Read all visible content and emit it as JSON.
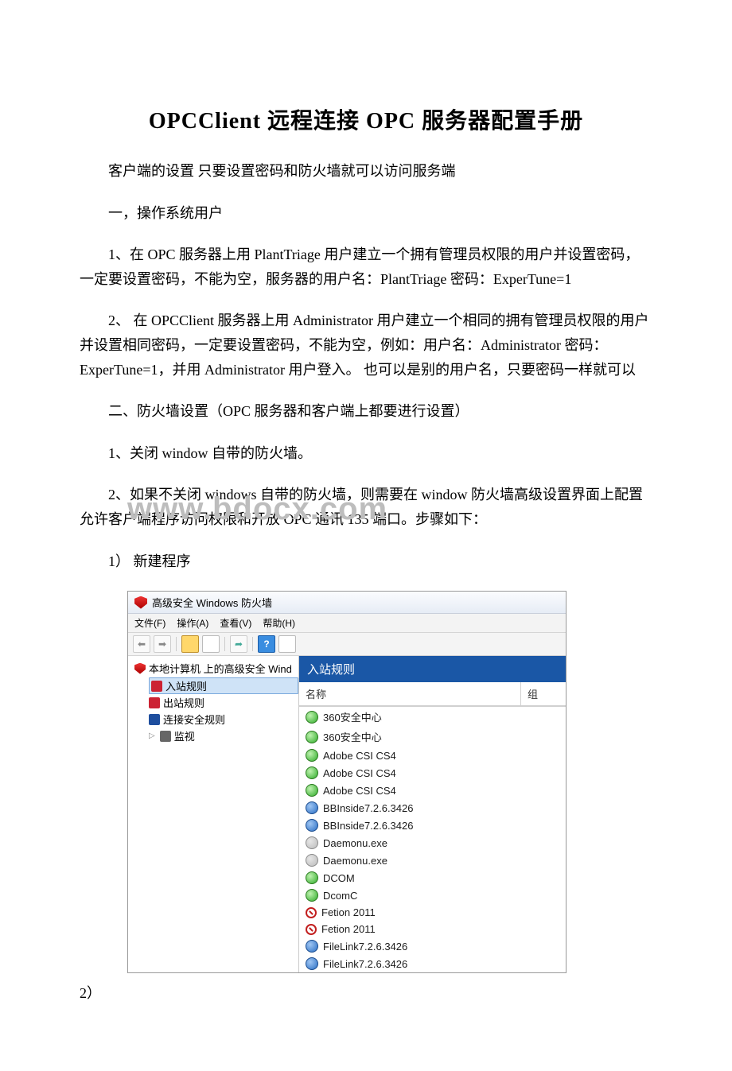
{
  "doc": {
    "title": "OPCClient 远程连接 OPC 服务器配置手册",
    "intro": "客户端的设置 只要设置密码和防火墙就可以访问服务端",
    "section1_heading": "一，操作系统用户",
    "section1_item1": "1、在 OPC 服务器上用 PlantTriage 用户建立一个拥有管理员权限的用户并设置密码，一定要设置密码，不能为空，服务器的用户名：PlantTriage 密码：ExperTune=1",
    "section1_item2": "2、 在 OPCClient 服务器上用 Administrator 用户建立一个相同的拥有管理员权限的用户并设置相同密码，一定要设置密码，不能为空，例如：用户名：Administrator 密码：ExperTune=1，并用 Administrator 用户登入。 也可以是别的用户名，只要密码一样就可以",
    "section2_heading": "二、防火墙设置（OPC 服务器和客户端上都要进行设置）",
    "section2_item1": "1、关闭 window 自带的防火墙。",
    "section2_item2": "2、如果不关闭 windows 自带的防火墙，则需要在 window 防火墙高级设置界面上配置允许客户端程序访问权限和开放 OPC 通讯 135 端口。步骤如下：",
    "step1": "1） 新建程序",
    "step2": "2）",
    "watermark": "www.bdocx.com"
  },
  "window": {
    "title": "高级安全 Windows 防火墙",
    "menu": {
      "file": "文件(F)",
      "action": "操作(A)",
      "view": "查看(V)",
      "help": "帮助(H)"
    },
    "tree": {
      "root": "本地计算机 上的高级安全 Wind",
      "inbound": "入站规则",
      "outbound": "出站规则",
      "conn": "连接安全规则",
      "monitor": "监视"
    },
    "content": {
      "header": "入站规则",
      "col_name": "名称",
      "col_group": "组",
      "rules": [
        {
          "status": "allow-green",
          "name": "360安全中心"
        },
        {
          "status": "allow-green",
          "name": "360安全中心"
        },
        {
          "status": "allow-green",
          "name": "Adobe CSI CS4"
        },
        {
          "status": "allow-green",
          "name": "Adobe CSI CS4"
        },
        {
          "status": "allow-green",
          "name": "Adobe CSI CS4"
        },
        {
          "status": "blue",
          "name": "BBInside7.2.6.3426"
        },
        {
          "status": "blue",
          "name": "BBInside7.2.6.3426"
        },
        {
          "status": "allow-gray",
          "name": "Daemonu.exe"
        },
        {
          "status": "allow-gray",
          "name": "Daemonu.exe"
        },
        {
          "status": "allow-green",
          "name": "DCOM"
        },
        {
          "status": "allow-green",
          "name": "DcomC"
        },
        {
          "status": "block",
          "name": "Fetion 2011"
        },
        {
          "status": "block",
          "name": "Fetion 2011"
        },
        {
          "status": "blue",
          "name": "FileLink7.2.6.3426"
        },
        {
          "status": "blue",
          "name": "FileLink7.2.6.3426"
        }
      ]
    }
  }
}
